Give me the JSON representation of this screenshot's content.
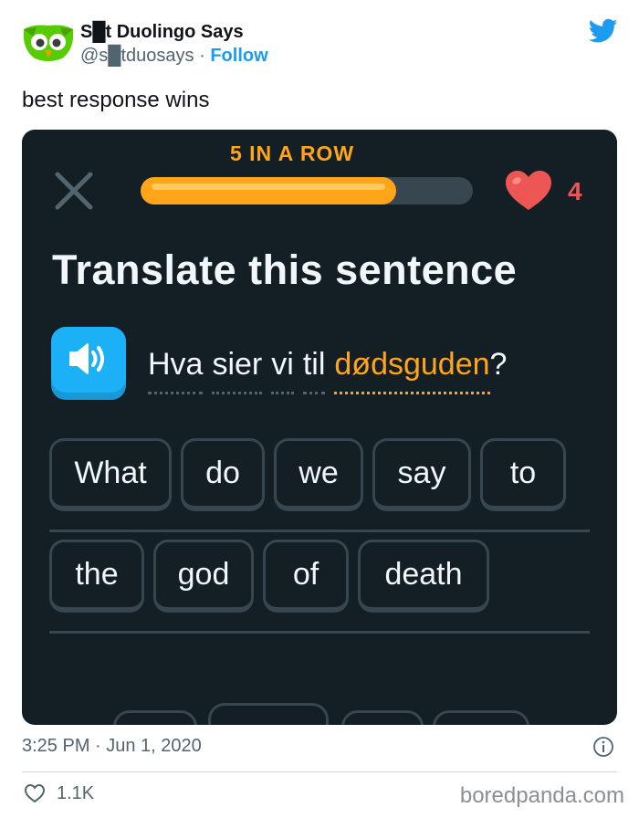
{
  "tweet": {
    "author_name": "S█t Duolingo Says",
    "handle": "@s█tduosays",
    "separator": "·",
    "follow_label": "Follow",
    "text": "best response wins",
    "timestamp": "3:25 PM · Jun 1, 2020",
    "like_count": "1.1K",
    "icons": [
      "owl-avatar",
      "twitter-bird-icon",
      "info-icon",
      "heart-outline-icon"
    ]
  },
  "duolingo": {
    "streak_label": "5 IN A ROW",
    "progress": 0.77,
    "hearts": "4",
    "prompt_title": "Translate this sentence",
    "sentence": {
      "words": [
        "Hva",
        "sier",
        "vi",
        "til"
      ],
      "highlight": "dødsguden",
      "punctuation": "?"
    },
    "answer_rows": [
      [
        "What",
        "do",
        "we",
        "say",
        "to"
      ],
      [
        "the",
        "god",
        "of",
        "death"
      ]
    ],
    "colors": {
      "background": "#131f24",
      "accent": "#ffa519",
      "heart": "#ee5555",
      "speaker": "#1cb0f6",
      "chip_border": "#37464f"
    }
  },
  "watermark": "boredpanda.com"
}
